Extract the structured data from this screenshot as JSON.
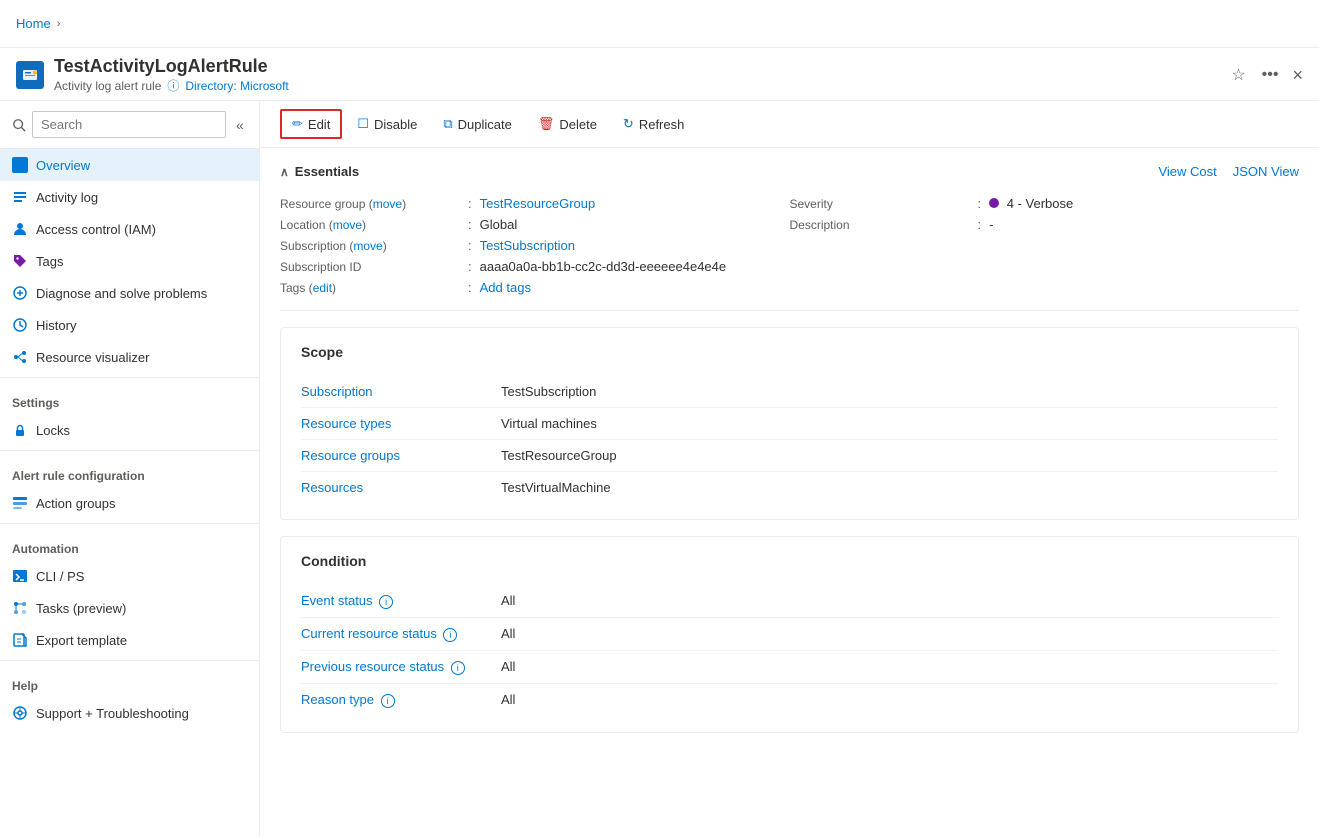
{
  "app": {
    "title": "TestActivityLogAlertRule",
    "subtitle": "Activity log alert rule",
    "directory_label": "Directory: Microsoft",
    "close_label": "×"
  },
  "breadcrumb": {
    "home": "Home",
    "separator": "›"
  },
  "search": {
    "placeholder": "Search"
  },
  "toolbar": {
    "edit_label": "Edit",
    "disable_label": "Disable",
    "duplicate_label": "Duplicate",
    "delete_label": "Delete",
    "refresh_label": "Refresh"
  },
  "sidebar": {
    "nav_items": [
      {
        "id": "overview",
        "label": "Overview",
        "active": true
      },
      {
        "id": "activity-log",
        "label": "Activity log"
      },
      {
        "id": "iam",
        "label": "Access control (IAM)"
      },
      {
        "id": "tags",
        "label": "Tags"
      },
      {
        "id": "diagnose",
        "label": "Diagnose and solve problems"
      },
      {
        "id": "history",
        "label": "History"
      },
      {
        "id": "resource-visualizer",
        "label": "Resource visualizer"
      }
    ],
    "sections": [
      {
        "header": "Settings",
        "items": [
          {
            "id": "locks",
            "label": "Locks"
          }
        ]
      },
      {
        "header": "Alert rule configuration",
        "items": [
          {
            "id": "action-groups",
            "label": "Action groups"
          }
        ]
      },
      {
        "header": "Automation",
        "items": [
          {
            "id": "cli-ps",
            "label": "CLI / PS"
          },
          {
            "id": "tasks-preview",
            "label": "Tasks (preview)"
          },
          {
            "id": "export-template",
            "label": "Export template"
          }
        ]
      },
      {
        "header": "Help",
        "items": [
          {
            "id": "support",
            "label": "Support + Troubleshooting"
          }
        ]
      }
    ]
  },
  "essentials": {
    "title": "Essentials",
    "view_cost": "View Cost",
    "json_view": "JSON View",
    "fields": {
      "resource_group_label": "Resource group",
      "resource_group_move": "move",
      "resource_group_value": "TestResourceGroup",
      "location_label": "Location",
      "location_move": "move",
      "location_value": "Global",
      "subscription_label": "Subscription",
      "subscription_move": "move",
      "subscription_value": "TestSubscription",
      "subscription_id_label": "Subscription ID",
      "subscription_id_value": "aaaa0a0a-bb1b-cc2c-dd3d-eeeeee4e4e4e",
      "tags_label": "Tags",
      "tags_edit": "edit",
      "tags_value": "Add tags",
      "severity_label": "Severity",
      "severity_value": "4 - Verbose",
      "description_label": "Description",
      "description_value": "-"
    }
  },
  "scope": {
    "title": "Scope",
    "fields": [
      {
        "label": "Subscription",
        "value": "TestSubscription"
      },
      {
        "label": "Resource types",
        "value": "Virtual machines"
      },
      {
        "label": "Resource groups",
        "value": "TestResourceGroup"
      },
      {
        "label": "Resources",
        "value": "TestVirtualMachine"
      }
    ]
  },
  "condition": {
    "title": "Condition",
    "fields": [
      {
        "label": "Event status",
        "value": "All",
        "has_info": true
      },
      {
        "label": "Current resource status",
        "value": "All",
        "has_info": true
      },
      {
        "label": "Previous resource status",
        "value": "All",
        "has_info": true
      },
      {
        "label": "Reason type",
        "value": "All",
        "has_info": true
      }
    ]
  }
}
